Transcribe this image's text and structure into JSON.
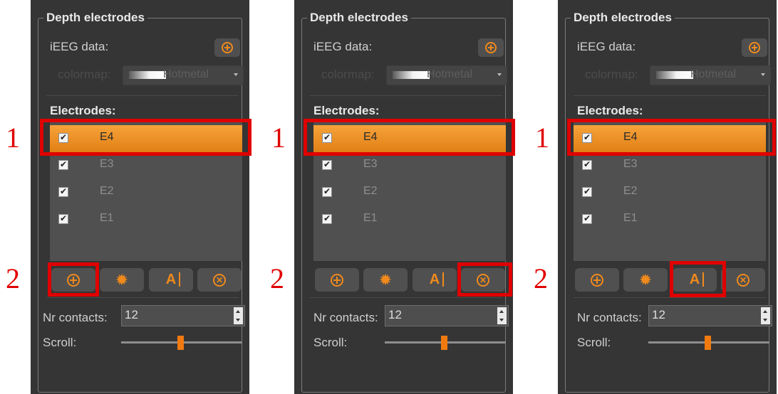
{
  "panels": [
    {
      "group_title": "Depth electrodes",
      "ieeg_label": "iEEG data:",
      "colormap_label": "colormap:",
      "colormap_value": "Hotmetal",
      "electrodes_title": "Electrodes:",
      "electrodes": [
        "E4",
        "E3",
        "E2",
        "E1"
      ],
      "selected_electrode": "E4",
      "nr_contacts_label": "Nr contacts:",
      "nr_contacts_value": "12",
      "scroll_label": "Scroll:",
      "scroll_position": 0.5,
      "highlighted_button": "add"
    },
    {
      "group_title": "Depth electrodes",
      "ieeg_label": "iEEG data:",
      "colormap_label": "colormap:",
      "colormap_value": "Hotmetal",
      "electrodes_title": "Electrodes:",
      "electrodes": [
        "E4",
        "E3",
        "E2",
        "E1"
      ],
      "selected_electrode": "E4",
      "nr_contacts_label": "Nr contacts:",
      "nr_contacts_value": "12",
      "scroll_label": "Scroll:",
      "scroll_position": 0.5,
      "highlighted_button": "remove"
    },
    {
      "group_title": "Depth electrodes",
      "ieeg_label": "iEEG data:",
      "colormap_label": "colormap:",
      "colormap_value": "Hotmetal",
      "electrodes_title": "Electrodes:",
      "electrodes": [
        "E4",
        "E3",
        "E2",
        "E1"
      ],
      "selected_electrode": "E4",
      "nr_contacts_label": "Nr contacts:",
      "nr_contacts_value": "12",
      "scroll_label": "Scroll:",
      "scroll_position": 0.5,
      "highlighted_button": "rename"
    }
  ],
  "markers": [
    "1",
    "2"
  ],
  "icons": {
    "add_button": "plus-circle-icon",
    "settings_button": "gear-icon",
    "rename_button": "text-cursor-icon",
    "remove_button": "close-circle-icon"
  },
  "colors": {
    "panel_background": "#353535",
    "accent": "#f08a1c",
    "selection": "#e98f22",
    "highlight_box": "#e00000"
  }
}
